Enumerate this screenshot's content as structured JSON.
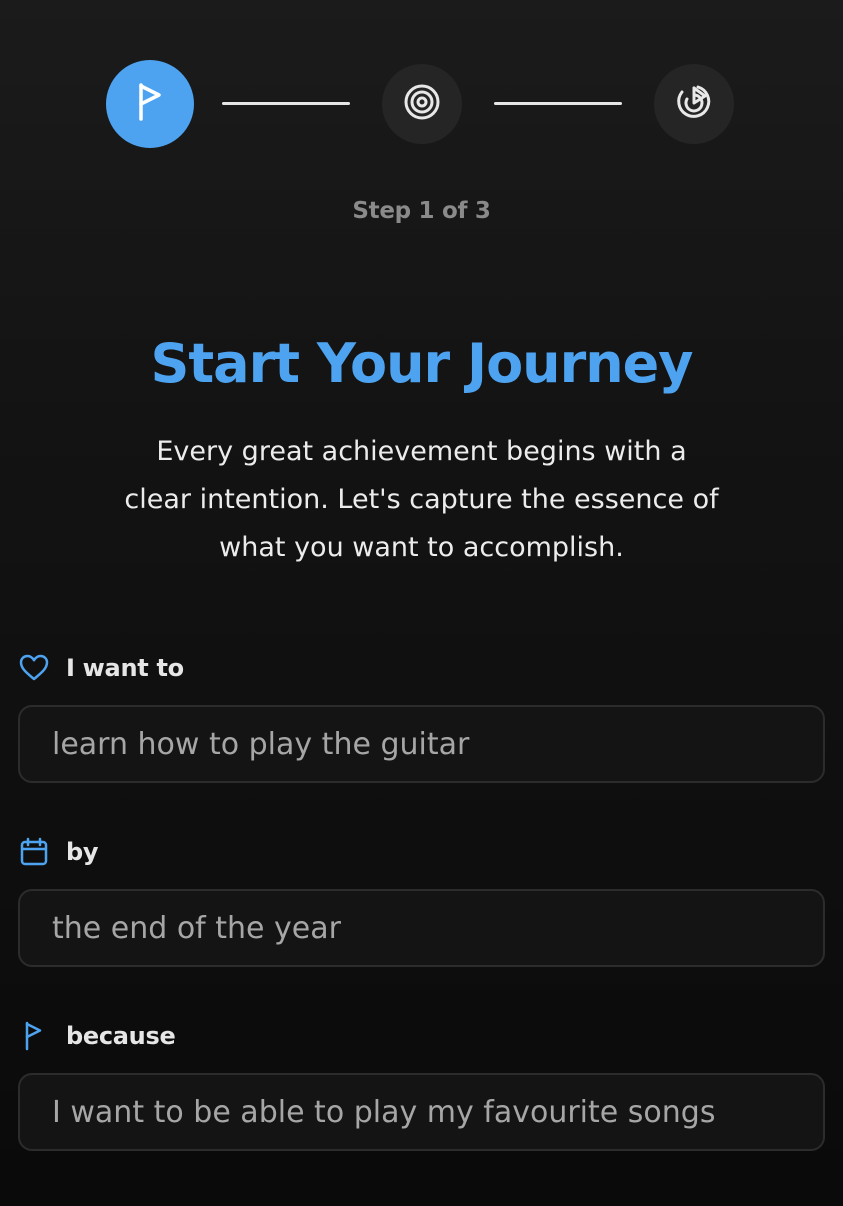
{
  "stepper": {
    "steps": [
      {
        "icon": "flag-icon",
        "state": "active"
      },
      {
        "icon": "target-icon",
        "state": "inactive"
      },
      {
        "icon": "radar-play-icon",
        "state": "inactive"
      }
    ],
    "indicator": "Step 1 of 3",
    "current_step": 1,
    "total_steps": 3
  },
  "hero": {
    "title": "Start Your Journey",
    "subtitle": "Every great achievement begins with a clear intention. Let's capture the essence of what you want to accomplish."
  },
  "form": {
    "fields": [
      {
        "label": "I want to",
        "icon": "heart-icon",
        "value": "learn how to play the guitar"
      },
      {
        "label": "by",
        "icon": "calendar-icon",
        "value": "the end of the year"
      },
      {
        "label": "because",
        "icon": "flag-icon",
        "value": "I want to be able to play my favourite songs"
      }
    ]
  },
  "colors": {
    "accent": "#4ea3f1",
    "background": "#121212",
    "inactive_step": "#252525",
    "input_background": "#141414",
    "input_border": "#2c2c2c",
    "input_text": "#a6a6a6"
  }
}
